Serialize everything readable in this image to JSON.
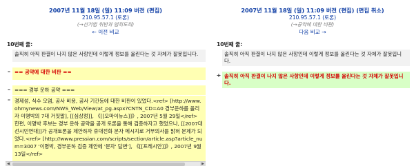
{
  "left": {
    "title_main": "2007년 11월 18일 (일) 11:09 버전",
    "title_edit": "(편집)",
    "ip": "210.95.57.1 (토론)",
    "summary": "(→선거법 위반과 범죄도피)",
    "nav": "← 이전 비교",
    "line_label": "10번째 줄:",
    "context": "솔직히 아직 판결이 나지 않은 사항인데 이렇게 정보를 올린다는 것 자체가 잘못입니다.",
    "removed_heading": "== 공약에 대한 비판 ==",
    "removed_sub": "=== 경부 운하 공약 ===",
    "removed_body": "경제성, 식수 오염, 공사 비용, 공사 기간등에 대한 비판이 있었다.<ref> [http://www.ohmynews.com/NWS_Web/View/at_pg.aspx?CNTN_CD=A0 경부운하를 올리자 이명박의 7대 거짓말], [[심상정]], 《[[오마이뉴스]]》, 2007년 5월 29일</ref> 한편, 이명박 후보는 경부 운하 공약을 공개 토론을 통해 검증하자고 했었으나, [[2007대선시민연대]]가 공개토론을 제안하자 휴대전화 문자 메시지로 거부의사를 밝혀 문제가 되었다.<ref> [http://www.pressian.com/scripts/section/article.asp?article_num=3007 '이명박, 경부운하 검증 제안에 '문자' 답변'], 《[[프레시안]]》, 2007년 9월 13일</ref>"
  },
  "right": {
    "title_main": "2007년 11월 18일 (일) 11:09 버전",
    "title_edit": "(편집)",
    "title_undo": "(편집 취소)",
    "ip": "210.95.57.1 (토론)",
    "summary": "(→공약에 대한 비판)",
    "nav": "다음 비교 →",
    "line_label": "10번째 줄:",
    "context": "솔직히 아직 판결이 나지 않은 사항인데 이렇게 정보를 올린다는 것 자체가 잘못입니다.",
    "added": "솔직히 아직 판결이 나지 않은 사항인데 이렇게 정보를 올린다는 것 자체가 잘못입니다."
  },
  "markers": {
    "minus": "–",
    "plus": "+"
  }
}
